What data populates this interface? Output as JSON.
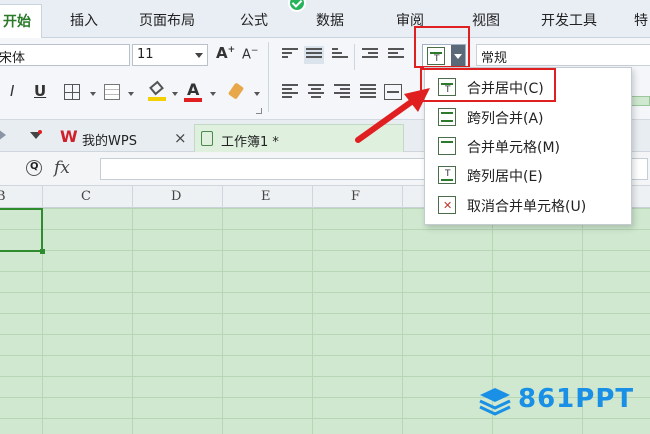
{
  "menu": {
    "tabs": [
      "开始",
      "插入",
      "页面布局",
      "公式",
      "数据",
      "审阅",
      "视图",
      "开发工具",
      "特"
    ]
  },
  "ribbon": {
    "font_name": "宋体",
    "font_size": "11",
    "number_format": "常规",
    "bold": "B",
    "italic": "I",
    "underline": "U",
    "font_color_label": "A",
    "grow_font": "A",
    "shrink_font": "A"
  },
  "doc_tabs": {
    "wps": "我的WPS",
    "close": "×",
    "workbook": "工作簿1 *"
  },
  "formula_bar": {
    "fx": "fx"
  },
  "grid": {
    "columns": [
      "B",
      "C",
      "D",
      "E",
      "F"
    ]
  },
  "merge_menu": {
    "items": [
      {
        "label": "合并居中(C)",
        "icon": "merge-center-icon"
      },
      {
        "label": "跨列合并(A)",
        "icon": "merge-across-icon"
      },
      {
        "label": "合并单元格(M)",
        "icon": "merge-cells-icon"
      },
      {
        "label": "跨列居中(E)",
        "icon": "center-across-icon"
      },
      {
        "label": "取消合并单元格(U)",
        "icon": "unmerge-cells-icon"
      }
    ]
  },
  "watermark": "861PPT",
  "colors": {
    "active_tab": "#2a7a2a",
    "highlight_box": "#e02020",
    "grid_fill": "#cfe8cf",
    "watermark": "#1a8fe6"
  }
}
